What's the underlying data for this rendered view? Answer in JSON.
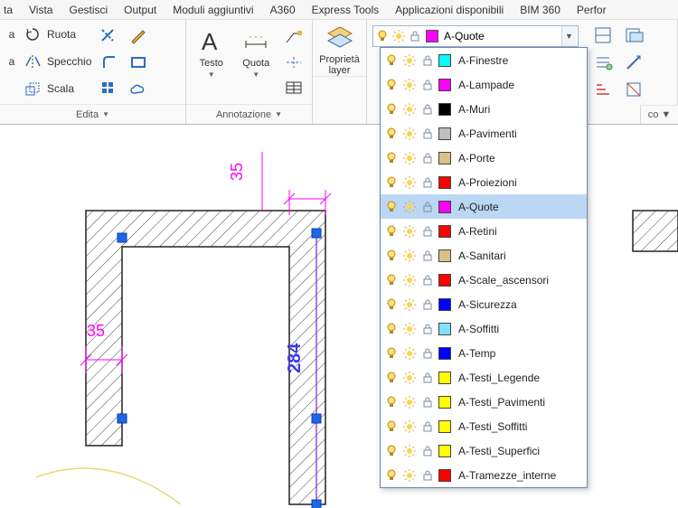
{
  "menu": [
    "ta",
    "Vista",
    "Gestisci",
    "Output",
    "Moduli aggiuntivi",
    "A360",
    "Express Tools",
    "Applicazioni disponibili",
    "BIM 360",
    "Perfor"
  ],
  "edita": {
    "title": "Edita",
    "rows": [
      {
        "icon": "rotate",
        "label": "Ruota"
      },
      {
        "icon": "mirror",
        "label": "Specchio"
      },
      {
        "icon": "scale",
        "label": "Scala"
      }
    ]
  },
  "annota": {
    "title": "Annotazione",
    "text_btn": "Testo",
    "dim_btn": "Quota"
  },
  "proplayer": {
    "line1": "Proprietà",
    "line2": "layer"
  },
  "combo": {
    "selected": "A-Quote",
    "swatch": "#ff00ff"
  },
  "co_label": "co",
  "dims": {
    "d1": "35",
    "d2": "35",
    "d3": "284"
  },
  "layers": [
    {
      "name": "A-Finestre",
      "color": "#00ffff"
    },
    {
      "name": "A-Lampade",
      "color": "#ff00ff"
    },
    {
      "name": "A-Muri",
      "color": "#000000"
    },
    {
      "name": "A-Pavimenti",
      "color": "#bfbfbf"
    },
    {
      "name": "A-Porte",
      "color": "#d9c187"
    },
    {
      "name": "A-Proiezioni",
      "color": "#ff0000"
    },
    {
      "name": "A-Quote",
      "color": "#ff00ff",
      "selected": true
    },
    {
      "name": "A-Retini",
      "color": "#ff0000"
    },
    {
      "name": "A-Sanitari",
      "color": "#d9c187"
    },
    {
      "name": "A-Scale_ascensori",
      "color": "#ff0000"
    },
    {
      "name": "A-Sicurezza",
      "color": "#0000ff"
    },
    {
      "name": "A-Soffitti",
      "color": "#80e0ff"
    },
    {
      "name": "A-Temp",
      "color": "#0000ff"
    },
    {
      "name": "A-Testi_Legende",
      "color": "#ffff00"
    },
    {
      "name": "A-Testi_Pavimenti",
      "color": "#ffff00"
    },
    {
      "name": "A-Testi_Soffitti",
      "color": "#ffff00"
    },
    {
      "name": "A-Testi_Superfici",
      "color": "#ffff00"
    },
    {
      "name": "A-Tramezze_interne",
      "color": "#ff0000"
    }
  ]
}
